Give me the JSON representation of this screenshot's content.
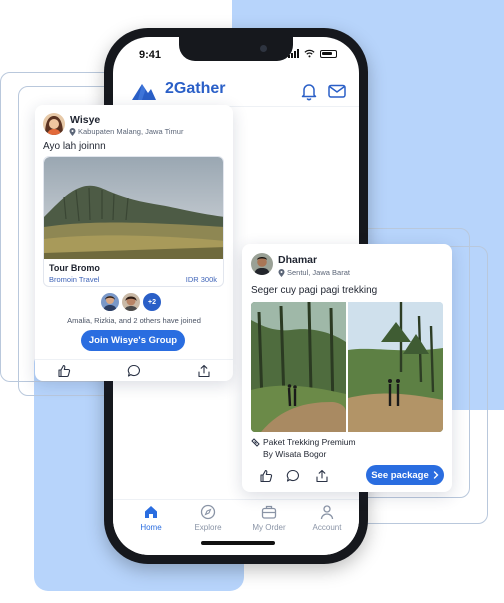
{
  "colors": {
    "accent": "#2a6de0",
    "brand": "#2a5fc7",
    "background_blob": "#b7d4fb"
  },
  "status_bar": {
    "time": "9:41"
  },
  "app": {
    "title": "2Gather",
    "icons": [
      "notification-bell-icon",
      "mail-icon"
    ]
  },
  "tabbar": {
    "tabs": [
      {
        "label": "Home",
        "icon": "home-icon",
        "active": true
      },
      {
        "label": "Explore",
        "icon": "compass-icon",
        "active": false
      },
      {
        "label": "My Order",
        "icon": "briefcase-icon",
        "active": false
      },
      {
        "label": "Account",
        "icon": "user-icon",
        "active": false
      }
    ]
  },
  "post_wisye": {
    "user_name": "Wisye",
    "location": "Kabupaten Malang, Jawa Timur",
    "text": "Ayo lah joinnn",
    "tour": {
      "name": "Tour Bromo",
      "agency": "Bromoin Travel",
      "price": "IDR 300k"
    },
    "joined_more": "+2",
    "joined_text": "Amalia, Rizkia, and 2 others have joined",
    "join_button": "Join Wisye's Group"
  },
  "post_dhamar": {
    "user_name": "Dhamar",
    "location": "Sentul, Jawa Barat",
    "text": "Seger cuy pagi pagi trekking",
    "package_name": "Paket Trekking Premium",
    "package_by": "By Wisata Bogor",
    "package_button": "See package"
  }
}
